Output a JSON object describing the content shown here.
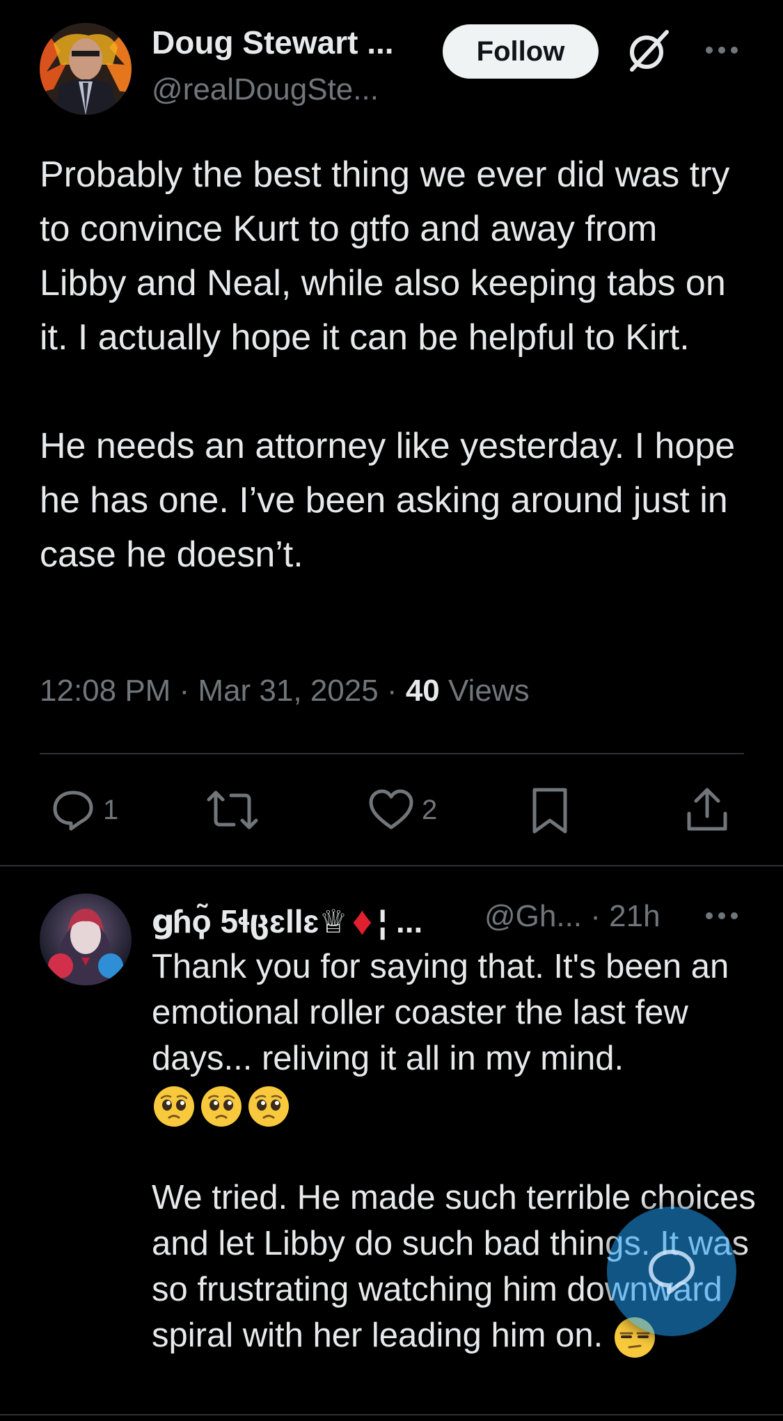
{
  "tweet": {
    "author_name": "Doug Stewart ...",
    "author_handle": "@realDougSte...",
    "follow_label": "Follow",
    "paragraphs": [
      "Probably the best thing we ever did was try to convince Kurt to gtfo and away from Libby and Neal, while also keeping tabs on it. I actually hope it can be helpful to Kirt.",
      "He needs an attorney like yesterday. I hope he has one. I’ve been asking around just in case he doesn’t."
    ],
    "timestamp": "12:08 PM · Mar 31, 2025 · ",
    "views_count": "40",
    "views_label": " Views"
  },
  "actions": {
    "replies": "1",
    "retweets": "",
    "likes": "2"
  },
  "reply": {
    "author_name": "ցɦϙ̃ 5ɬცɛllɛ♕",
    "name_suffix": "♦",
    "name_trail": "¦ ...",
    "handle_time": "@Gh... · 21h",
    "paragraph_1": "Thank you for saying that. It's been an emotional roller coaster the last few days... reliving it all in my mind.",
    "paragraph_2": "We tried. He made such terrible choices and let Libby do such bad things. It was so frustrating watching him downward spiral with her leading him on."
  },
  "colors": {
    "background": "#000000",
    "text": "#e7e9ea",
    "muted": "#71767b",
    "accent": "#1d9bf0",
    "divider": "#2f3336"
  },
  "icons": [
    "grok-icon",
    "more-icon",
    "reply-icon",
    "retweet-icon",
    "like-icon",
    "bookmark-icon",
    "share-icon",
    "compose-reply-icon",
    "pleading-face-emoji",
    "unamused-face-emoji"
  ]
}
